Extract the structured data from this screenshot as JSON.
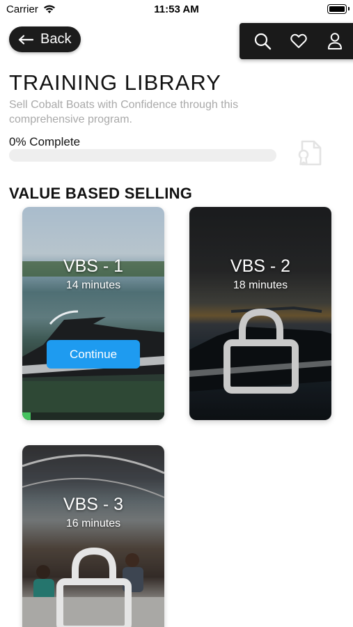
{
  "status_bar": {
    "carrier": "Carrier",
    "time": "11:53 AM"
  },
  "header": {
    "back_label": "Back",
    "actions": [
      {
        "icon": "search-icon"
      },
      {
        "icon": "heart-icon"
      },
      {
        "icon": "user-icon"
      }
    ]
  },
  "page": {
    "title": "TRAINING LIBRARY",
    "subtitle": "Sell Cobalt Boats with Confidence through this comprehensive program.",
    "progress_label": "0% Complete",
    "progress_fraction": 0.0,
    "certificate_icon": "certificate-icon"
  },
  "section": {
    "title": "VALUE BASED SELLING",
    "modules": [
      {
        "title": "VBS - 1",
        "duration": "14 minutes",
        "locked": false,
        "button_label": "Continue",
        "progress_fraction": 0.06
      },
      {
        "title": "VBS - 2",
        "duration": "18 minutes",
        "locked": true
      },
      {
        "title": "VBS - 3",
        "duration": "16 minutes",
        "locked": true
      }
    ]
  },
  "colors": {
    "accent": "#1e9bf0",
    "progress": "#46c35f",
    "dark": "#1c1c1c",
    "muted_text": "#a9a9a9"
  }
}
